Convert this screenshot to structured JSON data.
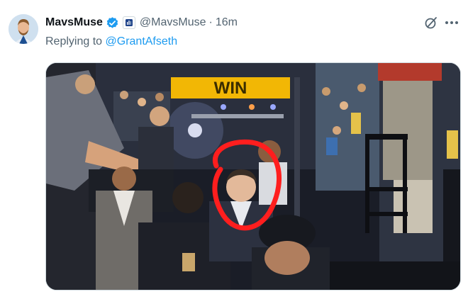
{
  "tweet": {
    "display_name": "MavsMuse",
    "handle": "@MavsMuse",
    "separator": "·",
    "time": "16m",
    "reply_prefix": "Replying to ",
    "reply_to": "@GrantAfseth"
  },
  "icons": {
    "verified": "verified-badge-icon",
    "affiliate": "affiliate-badge-icon",
    "grok": "grok-icon",
    "more": "more-dots-icon"
  },
  "media": {
    "banner_text": "WIN"
  },
  "colors": {
    "link": "#1d9bf0",
    "secondary_text": "#536471",
    "verified": "#1d9bf0",
    "banner": "#f2b705",
    "circle_annotation": "#ff1e1e"
  }
}
